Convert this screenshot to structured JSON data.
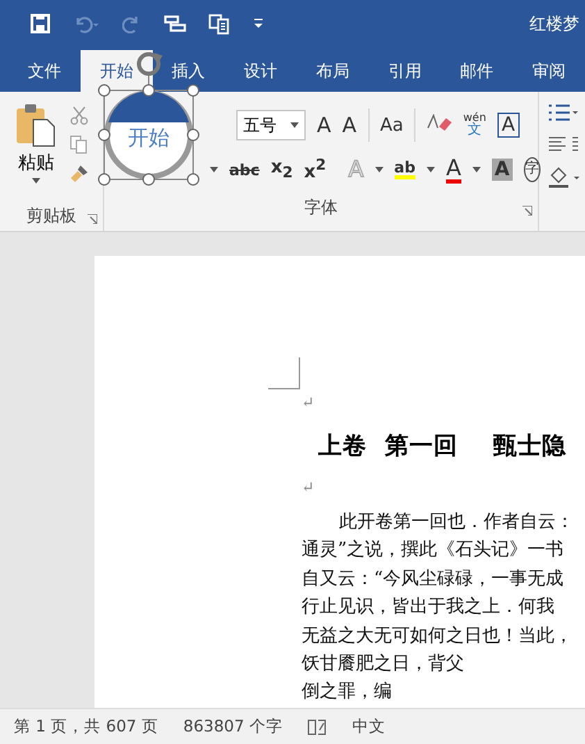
{
  "title_bar": {
    "quick_access": [
      {
        "kind": "save",
        "disabled": false
      },
      {
        "kind": "undo",
        "disabled": true
      },
      {
        "kind": "redo",
        "disabled": true
      },
      {
        "kind": "touch",
        "disabled": false
      },
      {
        "kind": "format",
        "disabled": false
      },
      {
        "kind": "more",
        "disabled": false
      }
    ],
    "title": "红楼梦"
  },
  "tabs": [
    {
      "label": "文件",
      "selected": false
    },
    {
      "label": "开始",
      "selected": true
    },
    {
      "label": "插入",
      "selected": false
    },
    {
      "label": "设计",
      "selected": false
    },
    {
      "label": "布局",
      "selected": false
    },
    {
      "label": "引用",
      "selected": false
    },
    {
      "label": "邮件",
      "selected": false
    },
    {
      "label": "审阅",
      "selected": false
    }
  ],
  "ribbon": {
    "clipboard": {
      "paste": "粘贴",
      "label": "剪贴板"
    },
    "font": {
      "label": "字体",
      "row1": [
        {
          "kind": "combo",
          "text": "五号"
        },
        {
          "kind": "glyph",
          "text": "A"
        },
        {
          "kind": "glyph",
          "text": "A"
        },
        {
          "kind": "sep"
        },
        {
          "kind": "dropglyph",
          "text": "Aa"
        },
        {
          "kind": "sep"
        },
        {
          "kind": "eraser"
        },
        {
          "kind": "phonetic",
          "text": "wén",
          "sub": "文"
        },
        {
          "kind": "boxed",
          "text": "A"
        }
      ],
      "row2": [
        {
          "kind": "drop"
        },
        {
          "kind": "strike",
          "text": "abc"
        },
        {
          "kind": "glyph",
          "text": "x$_{2}$"
        },
        {
          "kind": "glyph",
          "text": "x$^{2}$"
        },
        {
          "kind": "sep"
        },
        {
          "kind": "outline",
          "text": "A"
        },
        {
          "kind": "drop"
        },
        {
          "kind": "highlight",
          "text": "ab"
        },
        {
          "kind": "drop"
        },
        {
          "kind": "fontcolor",
          "text": "A"
        },
        {
          "kind": "drop"
        },
        {
          "kind": "shaded",
          "text": "A"
        },
        {
          "kind": "circled",
          "text": "字"
        }
      ]
    }
  },
  "shape": {
    "text": "开始",
    "selected": true
  },
  "document": {
    "heading": "上卷  第一回    甄士隐",
    "paragraph_marks": [
      "↵",
      "↵"
    ],
    "lines": [
      {
        "text": "此开卷第一回也．作者自云：",
        "indent": true
      },
      {
        "text": "通灵”之说，撰此《石头记》一书",
        "indent": false
      },
      {
        "text": "自又云：“今风尘碌碌，一事无成",
        "indent": false
      },
      {
        "text": "行止见识，皆出于我之上．何我",
        "indent": false
      },
      {
        "text": "无益之大无可如何之日也！当此，",
        "indent": false
      },
      {
        "text": "饫甘餍肥之日，背父",
        "indent": false
      },
      {
        "text": "倒之罪，编",
        "indent": false
      }
    ]
  },
  "status_bar": {
    "page": "第 1 页，共 607 页",
    "words": "863807 个字",
    "language": "中文"
  }
}
